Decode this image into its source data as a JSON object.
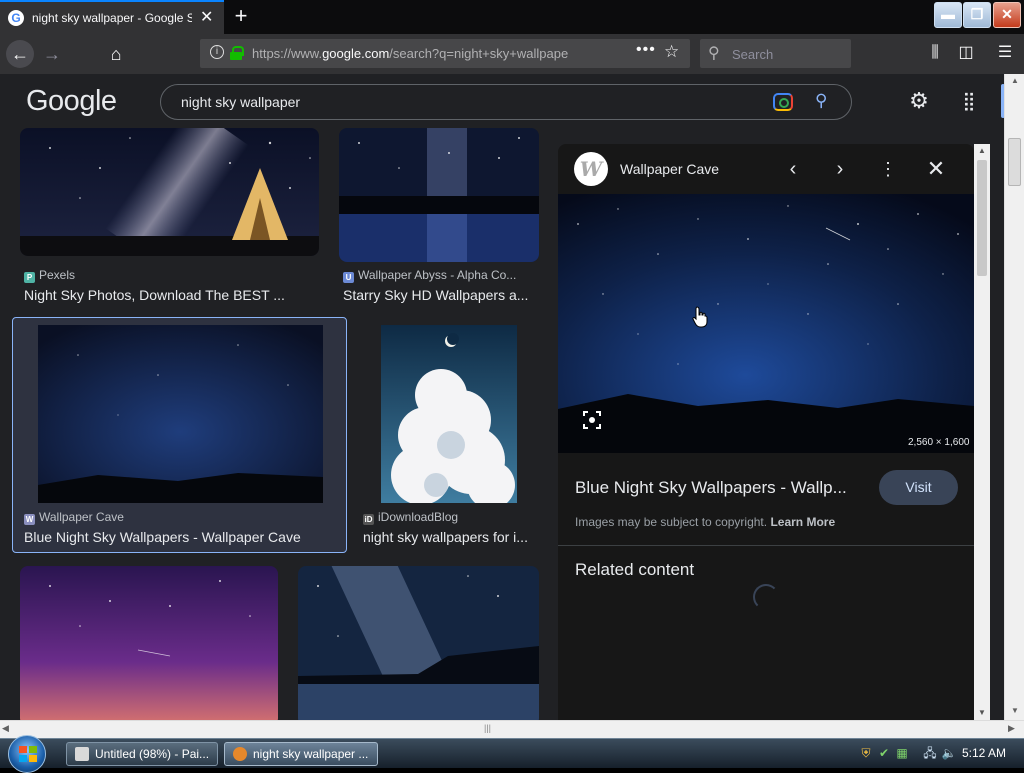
{
  "browser": {
    "tab_title": "night sky wallpaper - Google Se",
    "tab_favicon": "G",
    "tab_close": "✕",
    "new_tab": "+",
    "url_prefix": "https://www.",
    "url_domain": "google.com",
    "url_rest": "/search?q=night+sky+wallpape",
    "search_placeholder": "Search",
    "window_buttons": [
      "minimize-icon",
      "maximize-icon",
      "close-icon"
    ]
  },
  "google": {
    "logo": "Google",
    "query": "night sky wallpaper"
  },
  "results": [
    {
      "source": "Pexels",
      "title": "Night Sky Photos, Download The BEST ...",
      "source_icon_color": "#4fb3a5"
    },
    {
      "source": "Wallpaper Abyss - Alpha Co...",
      "title": "Starry Sky HD Wallpapers a...",
      "source_icon_color": "#6c8ad5"
    },
    {
      "source": "Wallpaper Cave",
      "title": "Blue Night Sky Wallpapers - Wallpaper Cave",
      "source_icon_color": "#8a8fbf"
    },
    {
      "source": "iDownloadBlog",
      "title": "night sky wallpapers for i...",
      "source_icon_color": "#555555"
    }
  ],
  "preview": {
    "site": "Wallpaper Cave",
    "site_logo_letter": "W",
    "dimensions": "2,560 × 1,600",
    "title": "Blue Night Sky Wallpapers - Wallp...",
    "visit_label": "Visit",
    "copyright_note": "Images may be subject to copyright.",
    "learn_more": "Learn More",
    "related_heading": "Related content"
  },
  "taskbar": {
    "tasks": [
      {
        "label": "Untitled (98%) - Pai..."
      },
      {
        "label": "night sky wallpaper ..."
      }
    ],
    "clock": "5:12 AM"
  },
  "colors": {
    "page_bg": "#202124",
    "panel_bg": "#171717",
    "accent": "#8ab4f8",
    "toolbar": "#323234"
  }
}
